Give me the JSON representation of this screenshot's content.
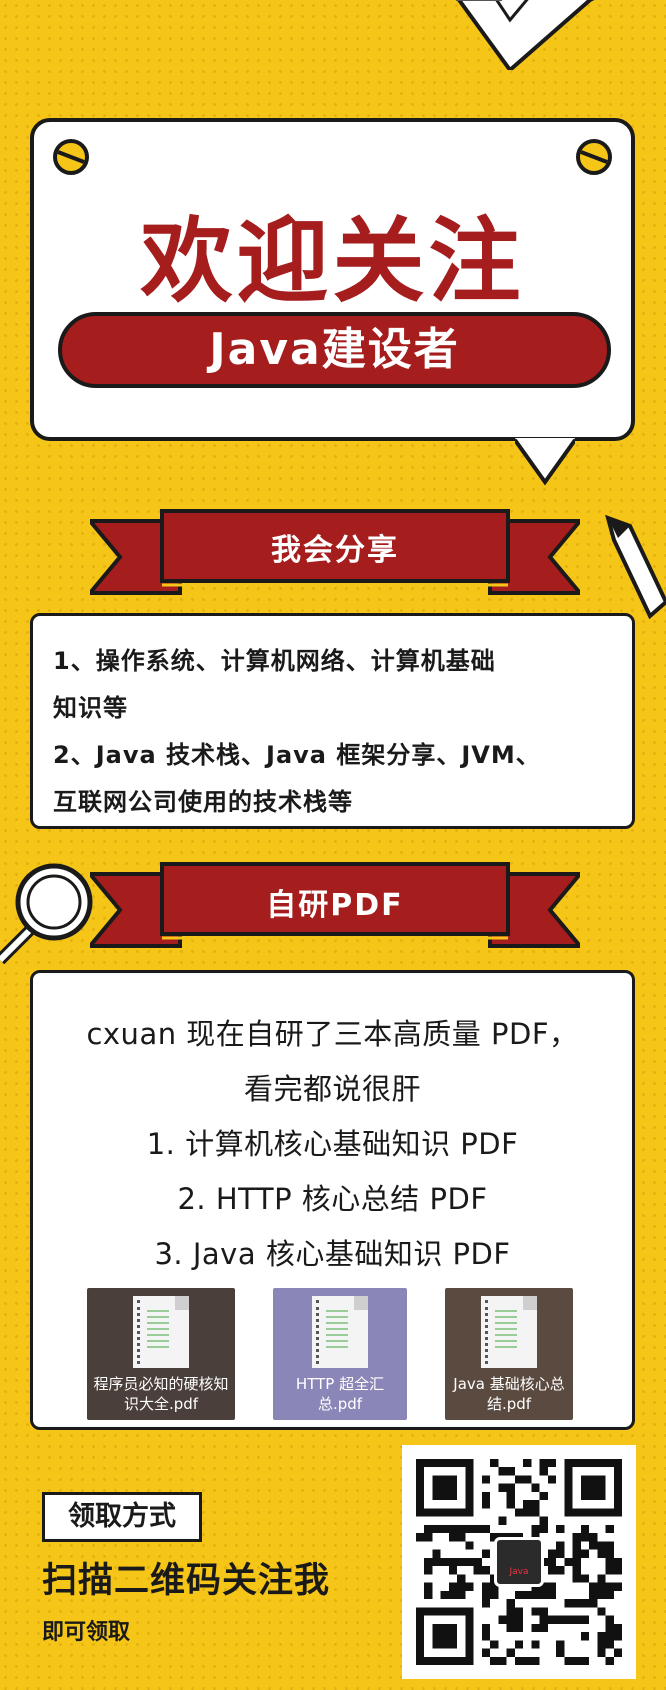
{
  "welcome": {
    "title": "欢迎关注",
    "name": "Java建设者"
  },
  "share_section": {
    "heading": "我会分享",
    "lines": [
      "1、操作系统、计算机网络、计算机基础",
      "知识等",
      "2、Java 技术栈、Java 框架分享、JVM、",
      "互联网公司使用的技术栈等"
    ]
  },
  "pdf_section": {
    "heading": "自研PDF",
    "intro": "cxuan 现在自研了三本高质量 PDF，",
    "intro2": "看完都说很肝",
    "items": [
      "1. 计算机核心基础知识 PDF",
      "2. HTTP 核心总结 PDF",
      "3. Java 核心基础知识 PDF"
    ],
    "thumbnails": [
      {
        "caption": "程序员必知的硬核知识大全.pdf",
        "bg": "#4a3f3a"
      },
      {
        "caption": "HTTP 超全汇总.pdf",
        "bg": "#8a86b8"
      },
      {
        "caption": "Java 基础核心总结.pdf",
        "bg": "#5a4a40"
      }
    ]
  },
  "bottom": {
    "method_label": "领取方式",
    "scan_text": "扫描二维码关注我",
    "get_text": "即可领取",
    "qr_center_text": "Java"
  },
  "colors": {
    "background": "#f5c518",
    "accent_red": "#a51d1d",
    "ink": "#1a1a1a"
  }
}
